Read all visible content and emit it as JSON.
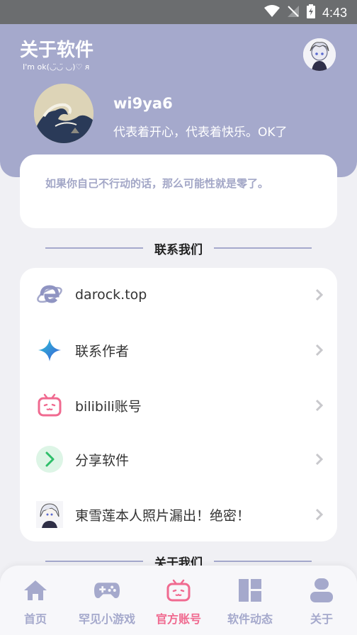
{
  "status_bar": {
    "time": "4:43",
    "icons": [
      "wifi-icon",
      "no-signal-icon",
      "battery-icon"
    ]
  },
  "header": {
    "title": "关于软件",
    "subtitle": "I'm ok(◡̈◡̈ ◡)♡ ᴙ",
    "username": "wi9ya6",
    "bio": "代表着开心，代表着快乐。OK了"
  },
  "quote": {
    "text": "如果你自己不行动的话，那么可能性就是零了。"
  },
  "contact_section": {
    "title": "联系我们",
    "items": [
      {
        "label": "darock.top",
        "icon": "internet-explorer-icon"
      },
      {
        "label": "联系作者",
        "icon": "sparkle-icon"
      },
      {
        "label": "bilibili账号",
        "icon": "bilibili-icon"
      },
      {
        "label": "分享软件",
        "icon": "share-arrow-icon"
      },
      {
        "label": "東雪莲本人照片漏出！绝密！",
        "icon": "anime-avatar-icon"
      }
    ]
  },
  "about_section": {
    "title": "关于我们"
  },
  "tab_bar": {
    "tabs": [
      {
        "label": "首页",
        "icon": "home-icon"
      },
      {
        "label": "罕见小游戏",
        "icon": "gamepad-icon"
      },
      {
        "label": "官方账号",
        "icon": "bilibili-tv-icon",
        "active": true
      },
      {
        "label": "软件动态",
        "icon": "dashboard-icon"
      },
      {
        "label": "关于",
        "icon": "person-icon"
      }
    ]
  },
  "colors": {
    "accent": "#a5a9cc",
    "active": "#f06a90",
    "background": "#f0f0f4"
  }
}
